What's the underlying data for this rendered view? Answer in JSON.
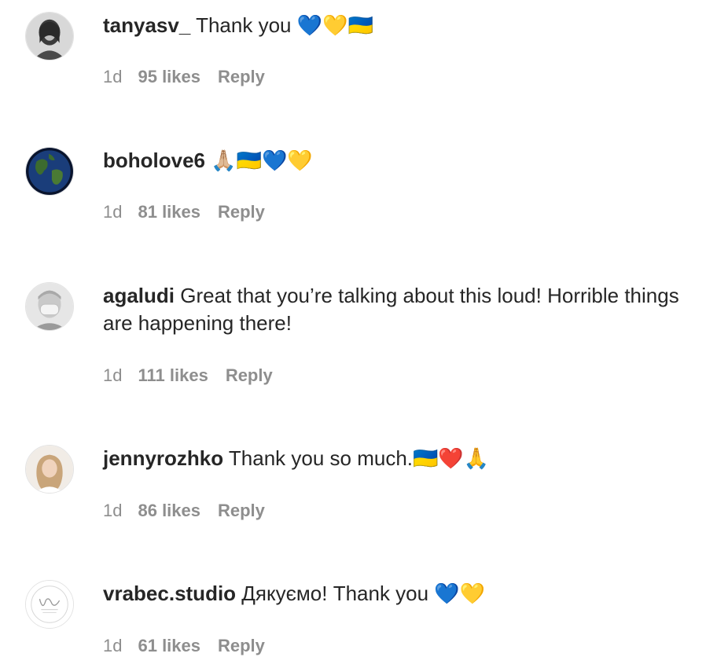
{
  "comments": [
    {
      "username": "tanyasv_",
      "text": "Thank you 💙💛🇺🇦",
      "time": "1d",
      "likes": "95 likes",
      "reply": "Reply",
      "avatar_icon": "profile-photo-woman-dark-hair"
    },
    {
      "username": "boholove6",
      "text": "🙏🏼🇺🇦💙💛",
      "time": "1d",
      "likes": "81 likes",
      "reply": "Reply",
      "avatar_icon": "profile-photo-globe"
    },
    {
      "username": "agaludi",
      "text": "Great that you’re talking about this loud! Horrible things are happening there!",
      "time": "1d",
      "likes": "111 likes",
      "reply": "Reply",
      "avatar_icon": "profile-photo-woman-face-mask"
    },
    {
      "username": "jennyrozhko",
      "text": "Thank you so much.🇺🇦❤️🙏",
      "time": "1d",
      "likes": "86 likes",
      "reply": "Reply",
      "avatar_icon": "profile-photo-woman-blonde"
    },
    {
      "username": "vrabec.studio",
      "text": "Дякуємо! Thank you 💙💛",
      "time": "1d",
      "likes": "61 likes",
      "reply": "Reply",
      "avatar_icon": "studio-logo"
    }
  ]
}
